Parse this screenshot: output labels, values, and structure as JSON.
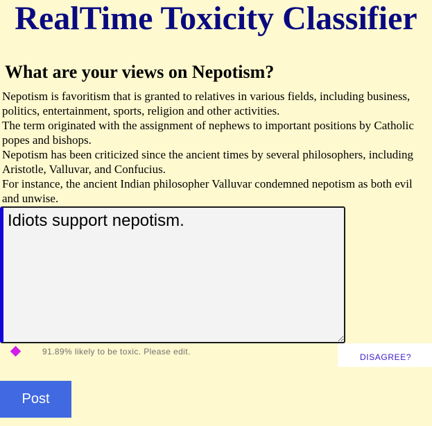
{
  "header": {
    "title": "RealTime Toxicity Classifier"
  },
  "prompt": {
    "question": "What are your views on Nepotism?",
    "paragraphs": [
      "Nepotism is favoritism that is granted to relatives in various fields, including business, politics, entertainment, sports, religion and other activities.",
      "The term originated with the assignment of nephews to important positions by Catholic popes and bishops.",
      "Nepotism has been criticized since the ancient times by several philosophers, including Aristotle, Valluvar, and Confucius.",
      "For instance, the ancient Indian philosopher Valluvar condemned nepotism as both evil and unwise."
    ]
  },
  "comment": {
    "value": "Idiots support nepotism."
  },
  "feedback": {
    "marker_icon": "diamond-icon",
    "marker_color": "#d21ee8",
    "message": "91.89% likely to be toxic. Please edit.",
    "toxicity_percent": 91.89,
    "disagree_label": "DISAGREE?"
  },
  "actions": {
    "post_label": "Post"
  },
  "colors": {
    "background": "#fef9cf",
    "title": "#0a0a80",
    "post_button": "#4169e1",
    "textarea_accent": "#1406d8"
  }
}
